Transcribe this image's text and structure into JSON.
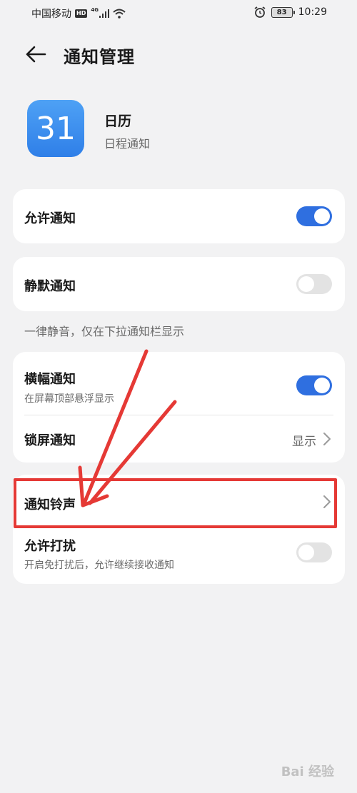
{
  "status_bar": {
    "carrier": "中国移动",
    "hd": "HD",
    "network": "4G",
    "battery": "83",
    "time": "10:29"
  },
  "header": {
    "title": "通知管理"
  },
  "app": {
    "icon_text": "31",
    "name": "日历",
    "description": "日程通知"
  },
  "settings": {
    "allow_notifications": {
      "label": "允许通知",
      "enabled": true
    },
    "silent_notifications": {
      "label": "静默通知",
      "enabled": false
    },
    "silent_helper": "一律静音，仅在下拉通知栏显示",
    "banner_notifications": {
      "label": "横幅通知",
      "sublabel": "在屏幕顶部悬浮显示",
      "enabled": true
    },
    "lock_screen_notifications": {
      "label": "锁屏通知",
      "value": "显示"
    },
    "notification_ringtone": {
      "label": "通知铃声"
    },
    "allow_interruptions": {
      "label": "允许打扰",
      "sublabel": "开启免打扰后，允许继续接收通知",
      "enabled": false
    }
  },
  "annotation": {
    "highlight_color": "#e53935"
  },
  "watermark": "Bai 经验"
}
